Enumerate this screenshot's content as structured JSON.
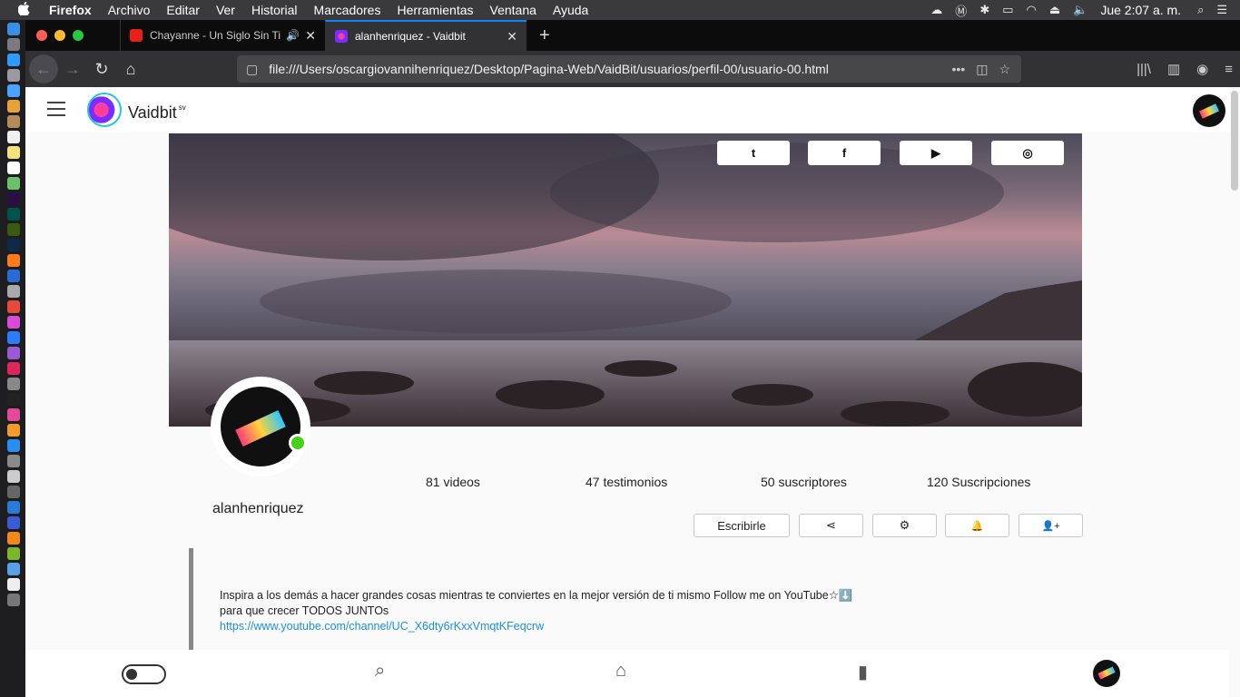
{
  "menubar": {
    "apple": "",
    "app": "Firefox",
    "items": [
      "Archivo",
      "Editar",
      "Ver",
      "Historial",
      "Marcadores",
      "Herramientas",
      "Ventana",
      "Ayuda"
    ],
    "clock": "Jue 2:07 a. m."
  },
  "tabs": [
    {
      "title": "Chayanne - Un Siglo Sin Ti (",
      "audio": "🔊",
      "close": "✕",
      "favicon_color": "#e62117"
    },
    {
      "title": "alanhenriquez - Vaidbit",
      "close": "✕",
      "favicon_color": "#8a2be2"
    }
  ],
  "newtab": "+",
  "navbar": {
    "back": "←",
    "forward": "→",
    "reload": "↻",
    "home": "⌂",
    "url": "file:///Users/oscargiovannihenriquez/Desktop/Pagina-Web/VaidBit/usuarios/perfil-00/usuario-00.html",
    "more": "•••",
    "pocket": "◫",
    "star": "☆",
    "library": "|||\\",
    "sidebar": "▥",
    "account": "◉",
    "menu": "≡"
  },
  "header": {
    "brand": "Vaidbit",
    "brand_sup": "sv"
  },
  "social": {
    "twitter": "t",
    "facebook": "f",
    "youtube": "▶",
    "instagram": "◎"
  },
  "profile": {
    "username": "alanhenriquez",
    "stats": [
      "81 videos",
      "47 testimonios",
      "50 suscriptores",
      "120 Suscripciones"
    ]
  },
  "actions": {
    "write": "Escribirle",
    "share": "⋖",
    "settings": "⚙",
    "notify": "🔔",
    "follow": "👤+"
  },
  "bio": {
    "text": "Inspira a los demás a hacer grandes cosas mientras te conviertes en la mejor versión de ti mismo Follow me on YouTube☆⬇️ para que crecer TODOS JUNTOs",
    "link": "https://www.youtube.com/channel/UC_X6dty6rKxxVmqtKFeqcrw"
  },
  "bottom": {
    "search": "⌕",
    "home": "⌂",
    "library": "▮"
  },
  "colors": {
    "accent": "#0a84ff",
    "online": "#46d016",
    "link": "#1a8fe0"
  }
}
